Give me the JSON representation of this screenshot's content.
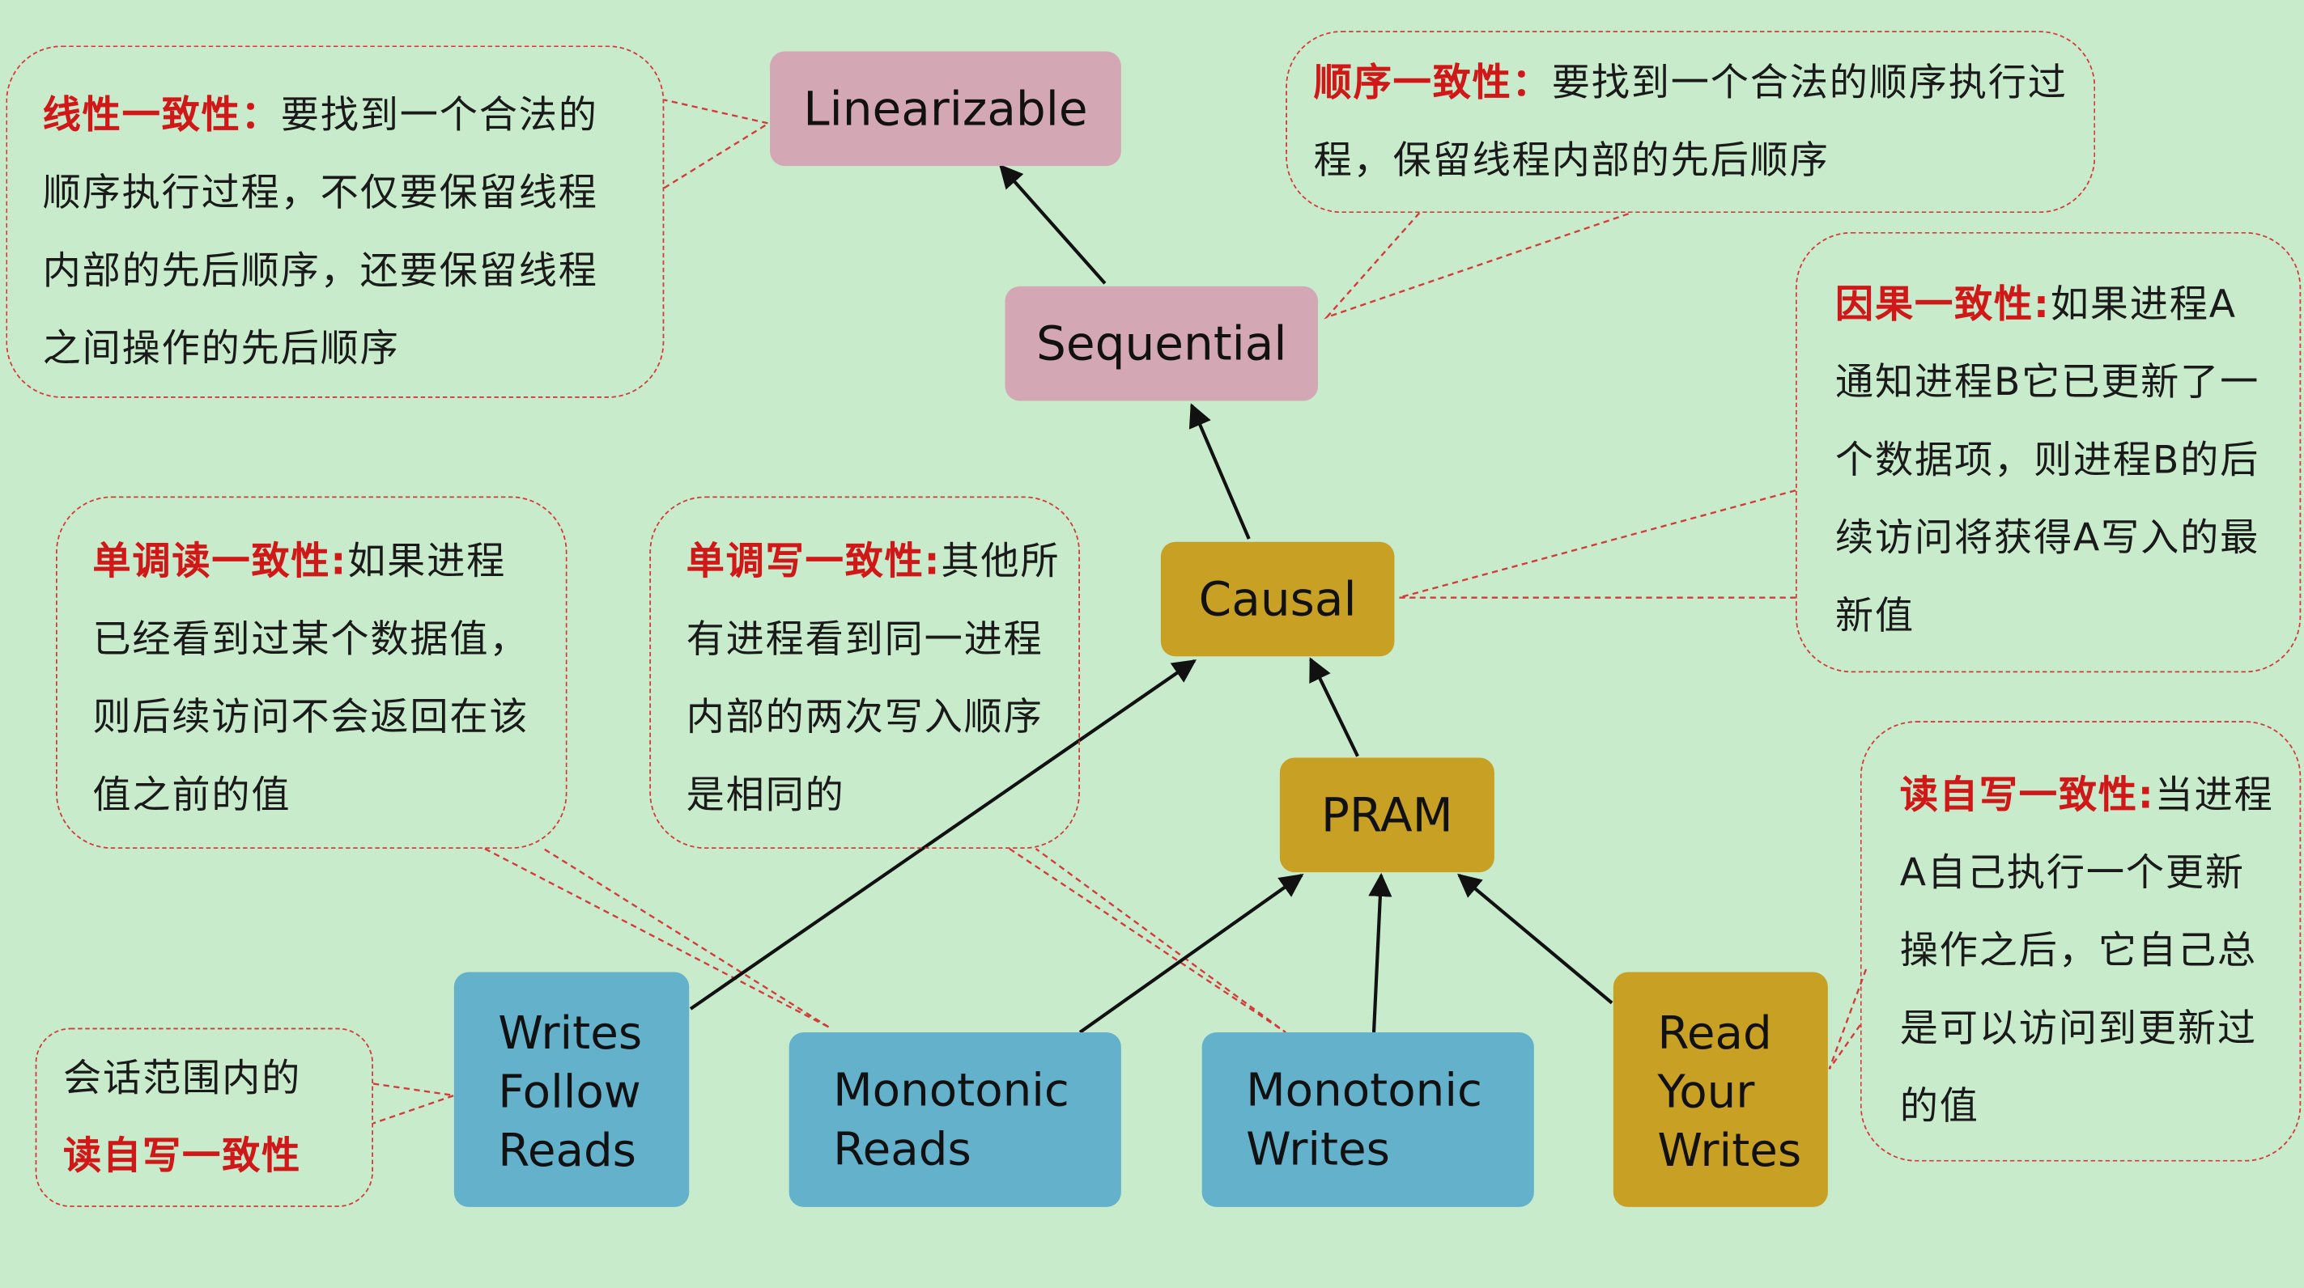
{
  "nodes": {
    "linearizable": "Linearizable",
    "sequential": "Sequential",
    "causal": "Causal",
    "pram": "PRAM",
    "wfr": "Writes\nFollow\nReads",
    "mr": "Monotonic\nReads",
    "mw": "Monotonic\nWrites",
    "ryw": "Read\nYour\nWrites"
  },
  "callouts": {
    "linear": {
      "title": "线性一致性",
      "sep": "：",
      "body": "要找到一个合法的顺序执行过程，不仅要保留线程内部的先后顺序，还要保留线程之间操作的先后顺序"
    },
    "sequential": {
      "title": "顺序一致性",
      "sep": "：",
      "body": "要找到一个合法的顺序执行过程，保留线程内部的先后顺序"
    },
    "causal": {
      "title": "因果一致性",
      "sep": ":",
      "body": "如果进程A通知进程B它已更新了一个数据项，则进程B的后续访问将获得A写入的最新值"
    },
    "monoread": {
      "title": "单调读一致性",
      "sep": ":",
      "body": "如果进程已经看到过某个数据值，则后续访问不会返回在该值之前的值"
    },
    "monowrite": {
      "title": "单调写一致性",
      "sep": ":",
      "body": "其他所有进程看到同一进程内部的两次写入顺序是相同的"
    },
    "ryw": {
      "title": "读自写一致性",
      "sep": ":",
      "body": "当进程A自己执行一个更新操作之后，它自己总是可以访问到更新过的值"
    },
    "session": {
      "body": "会话范围内的",
      "title": "读自写一致性"
    }
  },
  "colors": {
    "pink": "#d3a8b4",
    "gold": "#c8a024",
    "blue": "#64b1cc",
    "highlight": "#d01818",
    "dash": "#d53a3a",
    "background": "#c8ebcc"
  }
}
